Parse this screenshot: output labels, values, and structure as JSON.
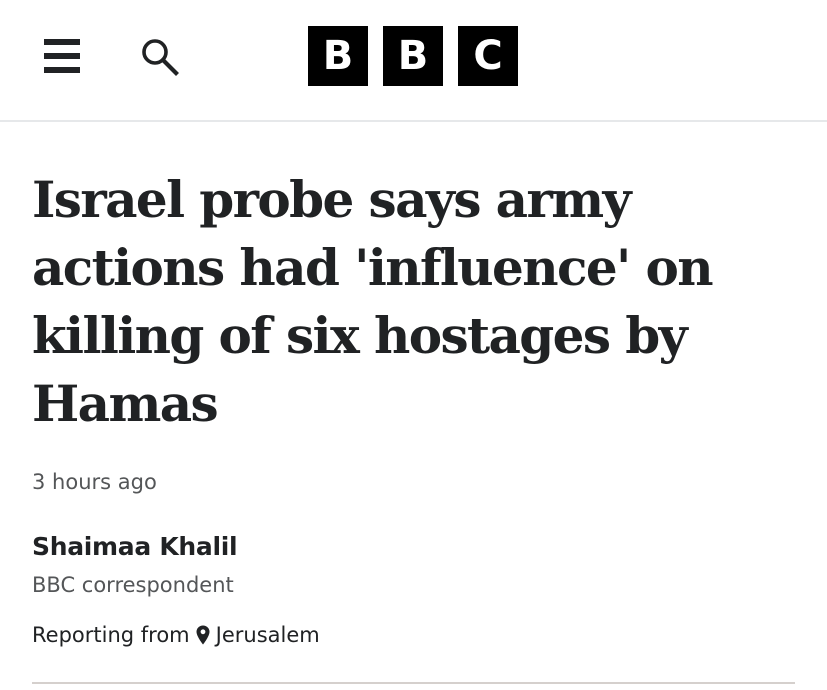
{
  "header": {
    "menu_icon": "hamburger-menu-icon",
    "search_icon": "search-icon",
    "logo_letters": [
      "B",
      "B",
      "C"
    ]
  },
  "article": {
    "headline": "Israel probe says army actions had 'influence' on killing of six hostages by Hamas",
    "timestamp": "3 hours ago",
    "author": {
      "name": "Shaimaa Khalil",
      "role": "BBC correspondent"
    },
    "reporting": {
      "prefix": "Reporting from",
      "location_icon": "location-pin-icon",
      "location": "Jerusalem"
    }
  },
  "colors": {
    "text_primary": "#202224",
    "text_secondary": "#545658",
    "logo_bg": "#000000",
    "logo_fg": "#ffffff",
    "divider": "#e6e8ea"
  }
}
